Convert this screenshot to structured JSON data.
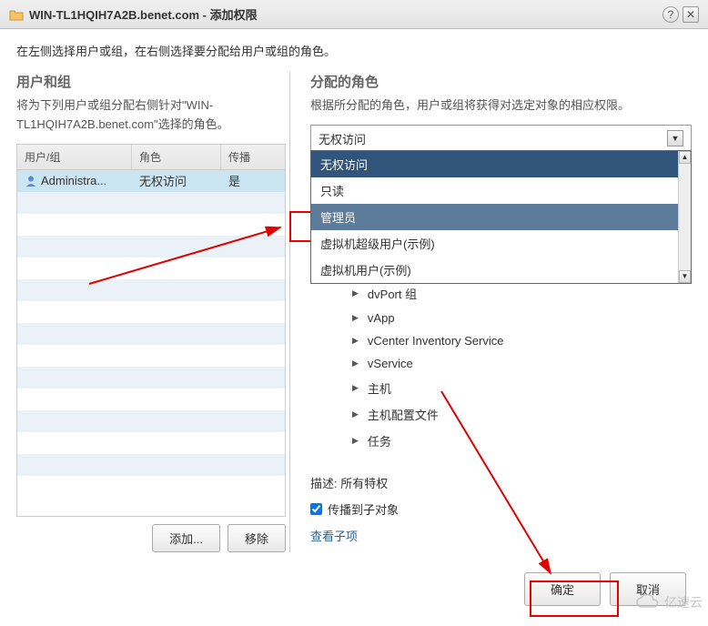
{
  "titlebar": {
    "title": "WIN-TL1HQIH7A2B.benet.com - 添加权限"
  },
  "instructions": "在左侧选择用户或组，在右侧选择要分配给用户或组的角色。",
  "left": {
    "heading": "用户和组",
    "desc": "将为下列用户或组分配右侧针对\"WIN-TL1HQIH7A2B.benet.com\"选择的角色。",
    "cols": {
      "user": "用户/组",
      "role": "角色",
      "propagate": "传播"
    },
    "rows": [
      {
        "user": "Administra...",
        "role": "无权访问",
        "propagate": "是"
      }
    ],
    "add_btn": "添加...",
    "remove_btn": "移除"
  },
  "right": {
    "heading": "分配的角色",
    "desc": "根据所分配的角色，用户或组将获得对选定对象的相应权限。",
    "selected_role": "无权访问",
    "dropdown": {
      "items": [
        {
          "label": "无权访问",
          "kind": "header"
        },
        {
          "label": "只读",
          "kind": "normal"
        },
        {
          "label": "管理员",
          "kind": "selected"
        },
        {
          "label": "虚拟机超级用户(示例)",
          "kind": "normal"
        },
        {
          "label": "虚拟机用户(示例)",
          "kind": "normal"
        }
      ]
    },
    "tree": [
      "dvPort 组",
      "vApp",
      "vCenter Inventory Service",
      "vService",
      "主机",
      "主机配置文件",
      "任务"
    ],
    "description_label": "描述:",
    "description_value": "所有特权",
    "propagate_label": "传播到子对象",
    "propagate_checked": true,
    "view_children": "查看子项"
  },
  "footer": {
    "ok": "确定",
    "cancel": "取消"
  },
  "watermark": "亿速云",
  "annot_colors": {
    "red": "#e00000"
  }
}
